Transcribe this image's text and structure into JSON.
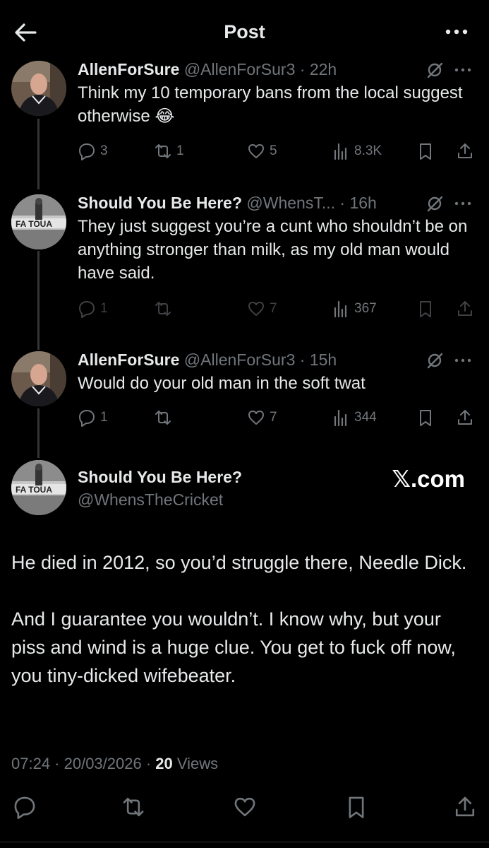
{
  "header": {
    "title": "Post"
  },
  "tweets": [
    {
      "name": "AllenForSure",
      "handle": "@AllenForSur3",
      "time": "· 22h",
      "text": "Think my 10 temporary bans from the local suggest otherwise 😂",
      "replies": "3",
      "retweets": "1",
      "likes": "5",
      "views": "8.3K"
    },
    {
      "name": "Should You Be Here?",
      "handle": "@WhensT...",
      "time": "· 16h",
      "text": "They just suggest you’re a cunt who shouldn’t be on anything stronger than milk, as my old man would have said.",
      "replies": "1",
      "retweets": "",
      "likes": "7",
      "views": "367"
    },
    {
      "name": "AllenForSure",
      "handle": "@AllenForSur3",
      "time": "· 15h",
      "text": "Would do your old man in the soft twat",
      "replies": "1",
      "retweets": "",
      "likes": "7",
      "views": "344"
    }
  ],
  "main": {
    "name": "Should You Be Here?",
    "handle": "@WhensTheCricket",
    "watermark": "𝕏.com",
    "paragraph1": "He died in 2012, so you’d struggle there, Needle Dick.",
    "paragraph2": "And I guarantee you wouldn’t. I know why, but your piss and wind is a huge clue. You get to fuck off now, you tiny-dicked wifebeater.",
    "timestamp": "07:24 · 20/03/2026 · ",
    "views_count": "20",
    "views_label": " Views"
  },
  "colors": {
    "background": "#000000",
    "text": "#e7e9ea",
    "muted": "#71767b",
    "line": "#333639"
  }
}
